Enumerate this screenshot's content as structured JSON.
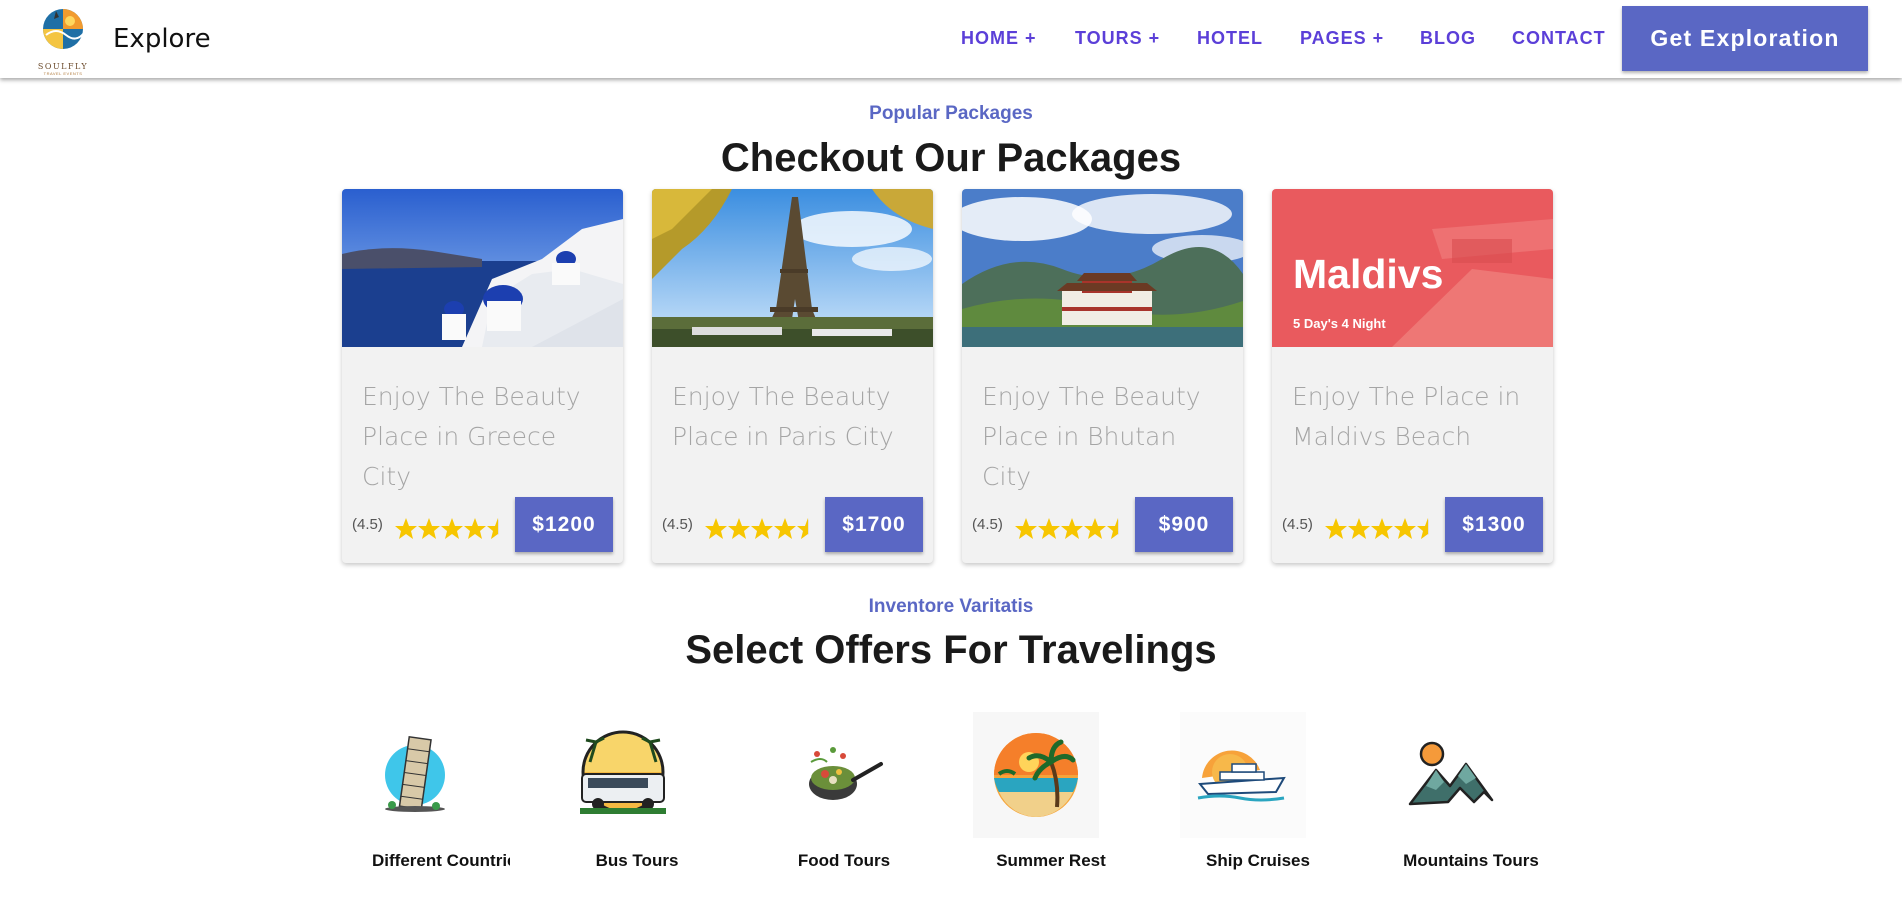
{
  "header": {
    "logo_text": "SOULFLY",
    "logo_subtext": "TRAVEL EVENTS",
    "brand": "Explore",
    "nav": [
      {
        "label": "HOME +"
      },
      {
        "label": "TOURS +"
      },
      {
        "label": "HOTEL"
      },
      {
        "label": "PAGES +"
      },
      {
        "label": "BLOG"
      },
      {
        "label": "CONTACT"
      }
    ],
    "cta_label": "Get Exploration"
  },
  "packages": {
    "eyebrow": "Popular Packages",
    "title": "Checkout Our Packages",
    "cards": [
      {
        "description": "Enjoy The Beauty Place in Greece City",
        "rating": "(4.5)",
        "rating_value": 4.5,
        "price": "$1200"
      },
      {
        "description": "Enjoy The Beauty Place in Paris City",
        "rating": "(4.5)",
        "rating_value": 4.5,
        "price": "$1700"
      },
      {
        "description": "Enjoy The Beauty Place in Bhutan City",
        "rating": "(4.5)",
        "rating_value": 4.5,
        "price": "$900"
      },
      {
        "description": "Enjoy The Place in Maldivs Beach",
        "rating": "(4.5)",
        "rating_value": 4.5,
        "price": "$1300",
        "overlay_title": "Maldivs",
        "overlay_subtitle": "5 Day's 4 Night"
      }
    ]
  },
  "offers": {
    "eyebrow": "Inventore Varitatis",
    "title": "Select Offers For Travelings",
    "items": [
      {
        "label": "Different Countries",
        "icon": "leaning-tower-icon"
      },
      {
        "label": "Bus Tours",
        "icon": "bus-icon"
      },
      {
        "label": "Food Tours",
        "icon": "food-pan-icon"
      },
      {
        "label": "Summer Rest",
        "icon": "beach-palm-icon"
      },
      {
        "label": "Ship Cruises",
        "icon": "cruise-ship-icon"
      },
      {
        "label": "Mountains Tours",
        "icon": "mountains-icon"
      }
    ]
  },
  "colors": {
    "accent": "#5a67c4",
    "nav": "#5b3fd8",
    "star": "#f7c600",
    "overlay_red": "#e95a5e"
  }
}
